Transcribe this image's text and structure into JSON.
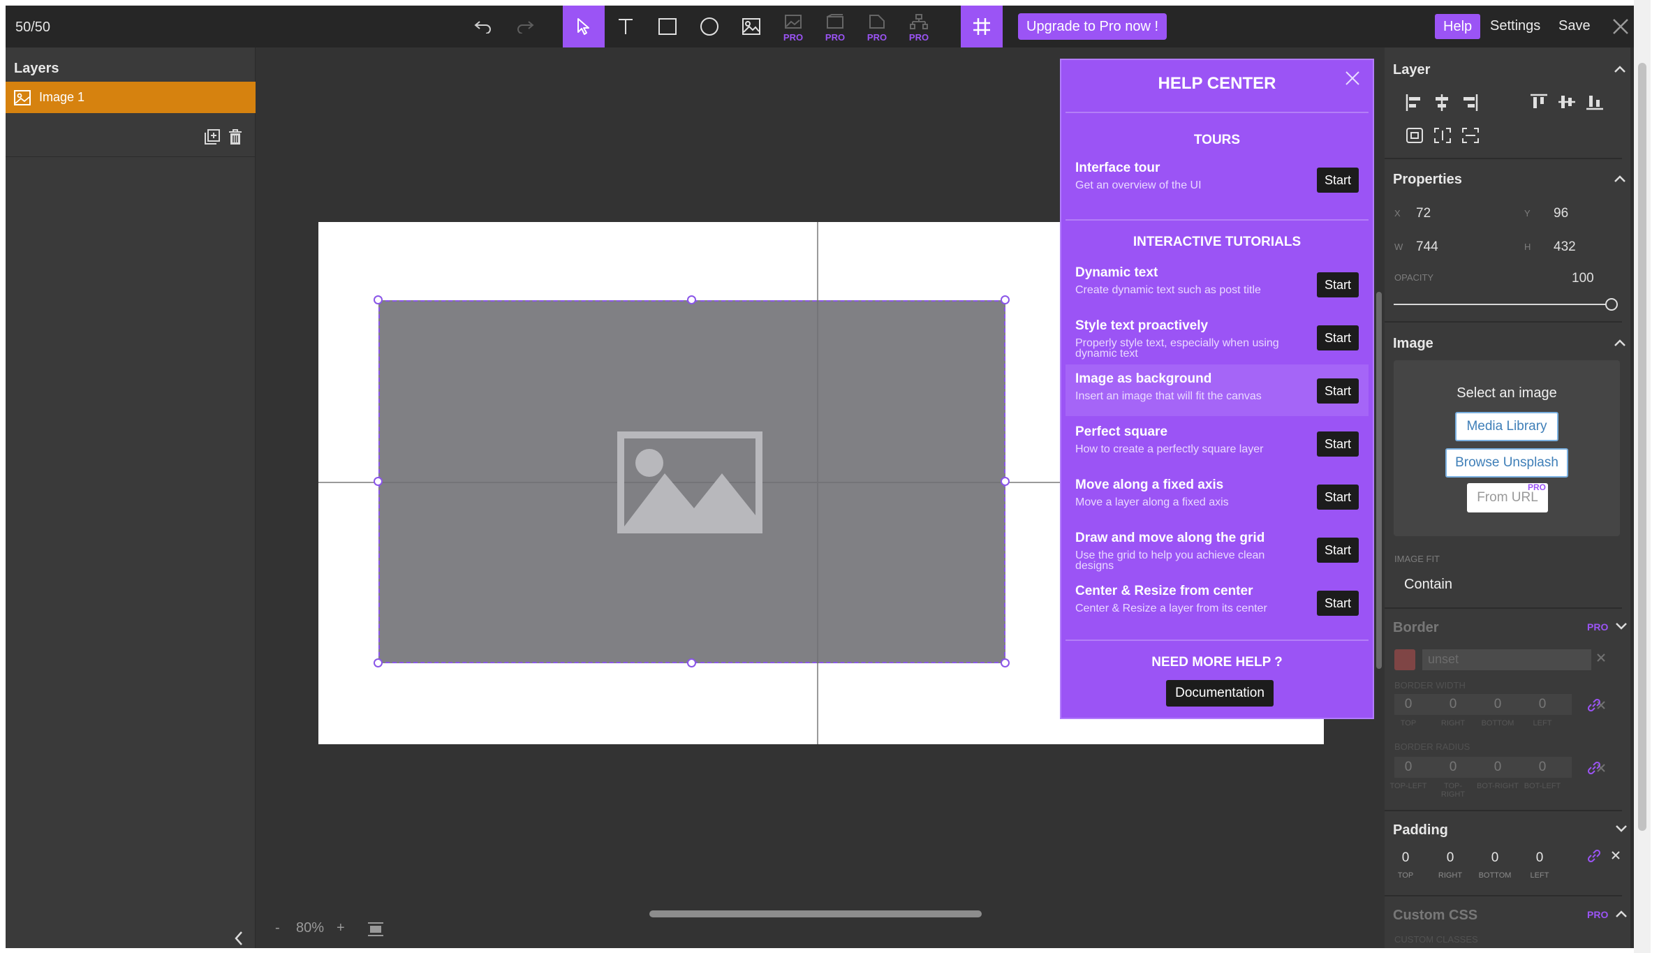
{
  "topbar": {
    "counter": "50/50",
    "pro_badge": "PRO",
    "upgrade_label": "Upgrade to Pro now !",
    "help_label": "Help",
    "settings_label": "Settings",
    "save_label": "Save",
    "tools": [
      "undo-icon",
      "redo-icon",
      "select-pointer-icon",
      "text-tool-icon",
      "rectangle-tool-icon",
      "ellipse-tool-icon",
      "image-tool-icon",
      "pro-image-tool-icon",
      "pro-video-tool-icon",
      "pro-shape-tool-icon",
      "pro-qr-tool-icon",
      "grid-toggle-icon"
    ],
    "accent": "#9b54f5"
  },
  "layers": {
    "title": "Layers",
    "items": [
      {
        "label": "Image 1",
        "icon": "image-icon"
      }
    ],
    "selected_color": "#d6820f"
  },
  "canvas": {
    "zoom_minus": "-",
    "zoom_value": "80%",
    "zoom_plus": "+"
  },
  "help_center": {
    "title": "HELP CENTER",
    "tours_title": "TOURS",
    "tours": [
      {
        "title": "Interface tour",
        "desc": "Get an overview of the UI",
        "button": "Start"
      }
    ],
    "tutorials_title": "INTERACTIVE TUTORIALS",
    "tutorials": [
      {
        "title": "Dynamic text",
        "desc": "Create dynamic text such as post title",
        "button": "Start"
      },
      {
        "title": "Style text proactively",
        "desc": "Properly style text, especially when using dynamic text",
        "button": "Start"
      },
      {
        "title": "Image as background",
        "desc": "Insert an image that will fit the canvas",
        "button": "Start"
      },
      {
        "title": "Perfect square",
        "desc": "How to create a perfectly square layer",
        "button": "Start"
      },
      {
        "title": "Move along a fixed axis",
        "desc": "Move a layer along a fixed axis",
        "button": "Start"
      },
      {
        "title": "Draw and move along the grid",
        "desc": "Use the grid to help you achieve clean designs",
        "button": "Start"
      },
      {
        "title": "Center & Resize from center",
        "desc": "Center & Resize a layer from its center",
        "button": "Start"
      }
    ],
    "more_help_title": "NEED MORE HELP ?",
    "documentation_label": "Documentation"
  },
  "props": {
    "layer_title": "Layer",
    "properties_title": "Properties",
    "x_label": "X",
    "x_value": "72",
    "y_label": "Y",
    "y_value": "96",
    "w_label": "W",
    "w_value": "744",
    "h_label": "H",
    "h_value": "432",
    "opacity_label": "OPACITY",
    "opacity_value": "100",
    "opacity_fraction": 1.0,
    "image_title": "Image",
    "select_image": "Select an image",
    "media_library": "Media Library",
    "browse_unsplash": "Browse Unsplash",
    "from_url": "From URL",
    "image_fit_label": "IMAGE FIT",
    "image_fit_value": "Contain",
    "border_title": "Border",
    "border_color_value": "unset",
    "border_width_label": "BORDER WIDTH",
    "border_radius_label": "BORDER RADIUS",
    "border_width_values": [
      "0",
      "0",
      "0",
      "0"
    ],
    "border_width_sides": [
      "TOP",
      "RIGHT",
      "BOTTOM",
      "LEFT"
    ],
    "border_radius_values": [
      "0",
      "0",
      "0",
      "0"
    ],
    "border_radius_corners": [
      "TOP-LEFT",
      "TOP-RIGHT",
      "BOT-RIGHT",
      "BOT-LEFT"
    ],
    "padding_title": "Padding",
    "padding_values": [
      "0",
      "0",
      "0",
      "0"
    ],
    "padding_sides": [
      "TOP",
      "RIGHT",
      "BOTTOM",
      "LEFT"
    ],
    "custom_css_title": "Custom CSS",
    "custom_classes_label": "CUSTOM CLASSES"
  }
}
